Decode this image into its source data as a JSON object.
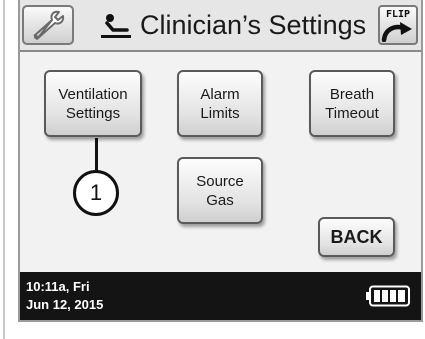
{
  "header": {
    "title": "Clinician’s Settings",
    "flip_label": "FLIP",
    "settings_icon": "wrench-icon",
    "clinician_icon": "clinician-icon",
    "flip_icon": "flip-arrow-icon"
  },
  "menu": {
    "ventilation_settings": "Ventilation\nSettings",
    "alarm_limits": "Alarm\nLimits",
    "breath_timeout": "Breath\nTimeout",
    "source_gas": "Source\nGas",
    "back": "BACK"
  },
  "callout": {
    "number": "1"
  },
  "status": {
    "time_day": "10:11a, Fri",
    "date": "Jun 12, 2015",
    "battery_icon": "battery-full-icon"
  }
}
